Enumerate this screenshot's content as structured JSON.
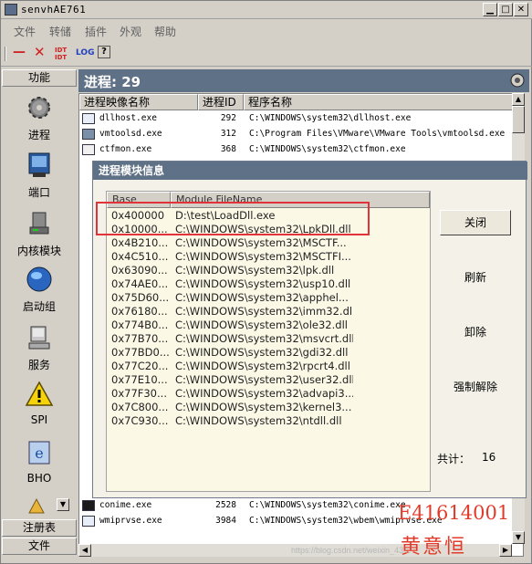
{
  "window": {
    "title": "senvhAE761"
  },
  "menu": [
    "文件",
    "转储",
    "插件",
    "外观",
    "帮助"
  ],
  "toolbar": {
    "btn_line": "—",
    "btn_x": "✕",
    "btn_idt": "IDT IDT",
    "btn_log": "LOG",
    "btn_help": "?"
  },
  "sidebar": {
    "header": "功能",
    "items": [
      "进程",
      "端口",
      "内核模块",
      "启动组",
      "服务",
      "SPI",
      "BHO"
    ],
    "footer_top": "注册表",
    "footer_bottom": "文件"
  },
  "main": {
    "heading": "进程: 29",
    "columns": [
      "进程映像名称",
      "进程ID",
      "程序名称"
    ],
    "rows_top": [
      {
        "name": "dllhost.exe",
        "pid": "292",
        "path": "C:\\WINDOWS\\system32\\dllhost.exe"
      },
      {
        "name": "vmtoolsd.exe",
        "pid": "312",
        "path": "C:\\Program Files\\VMware\\VMware Tools\\vmtoolsd.exe"
      },
      {
        "name": "ctfmon.exe",
        "pid": "368",
        "path": "C:\\WINDOWS\\system32\\ctfmon.exe"
      }
    ],
    "rows_bottom": [
      {
        "name": "conime.exe",
        "pid": "2528",
        "path": "C:\\WINDOWS\\system32\\conime.exe"
      },
      {
        "name": "wmiprvse.exe",
        "pid": "3984",
        "path": "C:\\WINDOWS\\system32\\wbem\\wmiprvse.exe"
      }
    ]
  },
  "dialog": {
    "title": "进程模块信息",
    "columns": [
      "Base",
      "Module FileName"
    ],
    "modules": [
      {
        "base": "0x400000",
        "file": "D:\\test\\LoadDll.exe"
      },
      {
        "base": "0x10000...",
        "file": "C:\\WINDOWS\\system32\\LpkDll.dll"
      },
      {
        "base": "0x4B210...",
        "file": "C:\\WINDOWS\\system32\\MSCTF..."
      },
      {
        "base": "0x4C510...",
        "file": "C:\\WINDOWS\\system32\\MSCTFI..."
      },
      {
        "base": "0x63090...",
        "file": "C:\\WINDOWS\\system32\\lpk.dll"
      },
      {
        "base": "0x74AE0...",
        "file": "C:\\WINDOWS\\system32\\usp10.dll"
      },
      {
        "base": "0x75D60...",
        "file": "C:\\WINDOWS\\system32\\apphel..."
      },
      {
        "base": "0x76180...",
        "file": "C:\\WINDOWS\\system32\\imm32.dll"
      },
      {
        "base": "0x774B0...",
        "file": "C:\\WINDOWS\\system32\\ole32.dll"
      },
      {
        "base": "0x77B70...",
        "file": "C:\\WINDOWS\\system32\\msvcrt.dll"
      },
      {
        "base": "0x77BD0...",
        "file": "C:\\WINDOWS\\system32\\gdi32.dll"
      },
      {
        "base": "0x77C20...",
        "file": "C:\\WINDOWS\\system32\\rpcrt4.dll"
      },
      {
        "base": "0x77E10...",
        "file": "C:\\WINDOWS\\system32\\user32.dll"
      },
      {
        "base": "0x77F30...",
        "file": "C:\\WINDOWS\\system32\\advapi3..."
      },
      {
        "base": "0x7C800...",
        "file": "C:\\WINDOWS\\system32\\kernel3..."
      },
      {
        "base": "0x7C930...",
        "file": "C:\\WINDOWS\\system32\\ntdll.dll"
      }
    ],
    "buttons": {
      "close": "关闭",
      "refresh": "刷新",
      "unload": "卸除",
      "force_unload": "强制解除"
    },
    "total_label": "共计：",
    "total_value": "16"
  },
  "overlay": {
    "id": "E41614001",
    "name": "黄意恒",
    "watermark": "https://blog.csdn.net/weixin_43..."
  },
  "colors": {
    "accent": "#5f7186",
    "highlight": "#e0333a"
  }
}
